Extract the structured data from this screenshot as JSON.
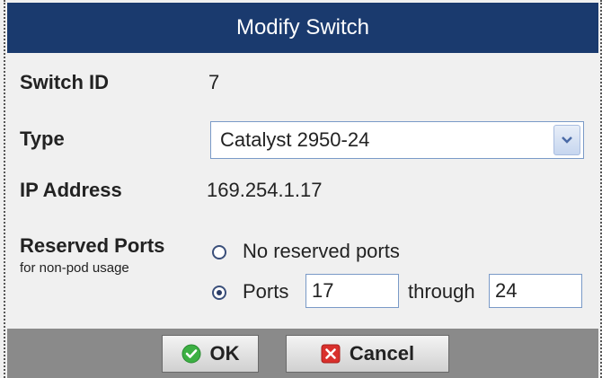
{
  "dialog": {
    "title": "Modify Switch"
  },
  "fields": {
    "switch_id_label": "Switch ID",
    "switch_id_value": "7",
    "type_label": "Type",
    "type_value": "Catalyst 2950-24",
    "ip_label": "IP Address",
    "ip_value": "169.254.1.17",
    "reserved_label": "Reserved Ports",
    "reserved_sublabel": "for non-pod usage",
    "no_reserved_label": "No reserved ports",
    "ports_label": "Ports",
    "ports_from": "17",
    "through_label": "through",
    "ports_to": "24"
  },
  "radio_state": {
    "selected": "ports"
  },
  "buttons": {
    "ok_label": "OK",
    "cancel_label": "Cancel"
  },
  "colors": {
    "titlebar": "#1a3a6e",
    "footer": "#8a8a8a",
    "ok_icon": "#3cb043",
    "cancel_icon": "#d9302c"
  },
  "icons": {
    "dropdown": "chevron-down-icon",
    "ok": "checkmark-icon",
    "cancel": "close-icon"
  }
}
